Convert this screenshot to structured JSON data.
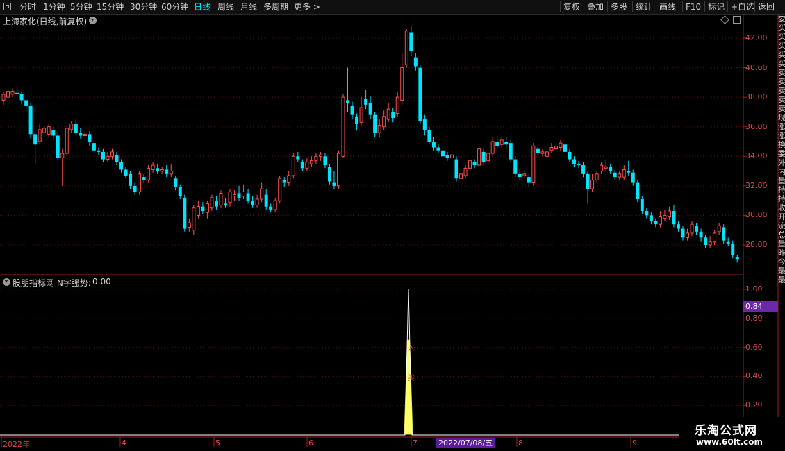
{
  "toolbar": {
    "left": [
      "分时",
      "1分钟",
      "5分钟",
      "15分钟",
      "30分钟",
      "60分钟",
      "日线",
      "周线",
      "月线",
      "多周期",
      "更多 >"
    ],
    "active_index": 6,
    "right": [
      "复权",
      "叠加",
      "多股",
      "统计",
      "画线",
      "F10",
      "标记",
      "+自选",
      "返回"
    ]
  },
  "chart": {
    "stock_title": "上海家化(日线,前复权)",
    "price_axis": [
      "42.00",
      "40.00",
      "38.00",
      "36.00",
      "34.00",
      "32.00",
      "30.00",
      "28.00"
    ],
    "indicator_title": "股朋指标网 N字强势:",
    "indicator_value": "0.00",
    "indicator_axis": [
      "1.00",
      "0.80",
      "0.60",
      "0.40",
      "0.20"
    ],
    "current_value": "0.84",
    "date_badge": "2022/07/08/五",
    "time_axis": [
      "2022年",
      "4",
      "5",
      "6",
      "7",
      "8",
      "9"
    ],
    "signal_labels": [
      "买",
      "入"
    ],
    "up_color": "#ff5050",
    "down_color": "#00e5ff"
  },
  "right_strip": "委买买买买买卖卖卖卖卖现涨涨换委外内量持持收开流总量昨今最最",
  "watermark": {
    "title": "乐淘公式网",
    "url": "www.60lt.com"
  },
  "chart_data": {
    "type": "candlestick",
    "price_axis_range": [
      27,
      43
    ],
    "indicator": {
      "name": "N字强势",
      "range": [
        0,
        1
      ],
      "peak": 1.0,
      "fill_peak": 0.65,
      "peak_date": "2022/07/08"
    },
    "candles": [
      {
        "o": 37.8,
        "c": 38.2,
        "h": 38.4,
        "l": 37.5
      },
      {
        "o": 38.0,
        "c": 38.4,
        "h": 38.6,
        "l": 37.8
      },
      {
        "o": 38.2,
        "c": 38.4,
        "h": 38.6,
        "l": 38.0
      },
      {
        "o": 38.3,
        "c": 38.2,
        "h": 38.9,
        "l": 37.9
      },
      {
        "o": 38.2,
        "c": 37.8,
        "h": 38.4,
        "l": 37.5
      },
      {
        "o": 37.8,
        "c": 37.4,
        "h": 38.0,
        "l": 37.1
      },
      {
        "o": 37.4,
        "c": 35.5,
        "h": 37.6,
        "l": 35.2
      },
      {
        "o": 35.5,
        "c": 34.8,
        "h": 35.8,
        "l": 33.5
      },
      {
        "o": 35.0,
        "c": 35.8,
        "h": 36.2,
        "l": 34.8
      },
      {
        "o": 35.6,
        "c": 35.9,
        "h": 36.1,
        "l": 35.3
      },
      {
        "o": 35.5,
        "c": 36.0,
        "h": 36.2,
        "l": 35.3
      },
      {
        "o": 35.8,
        "c": 35.4,
        "h": 36.0,
        "l": 35.1
      },
      {
        "o": 35.4,
        "c": 33.9,
        "h": 35.6,
        "l": 33.7
      },
      {
        "o": 33.9,
        "c": 34.2,
        "h": 34.5,
        "l": 32.0
      },
      {
        "o": 34.2,
        "c": 35.9,
        "h": 36.1,
        "l": 34.0
      },
      {
        "o": 35.8,
        "c": 36.2,
        "h": 36.4,
        "l": 35.6
      },
      {
        "o": 36.2,
        "c": 35.6,
        "h": 36.5,
        "l": 35.4
      },
      {
        "o": 35.6,
        "c": 35.4,
        "h": 35.9,
        "l": 35.2
      },
      {
        "o": 35.4,
        "c": 35.5,
        "h": 35.8,
        "l": 35.1
      },
      {
        "o": 35.5,
        "c": 35.0,
        "h": 35.7,
        "l": 34.7
      },
      {
        "o": 34.9,
        "c": 34.4,
        "h": 35.1,
        "l": 34.2
      },
      {
        "o": 34.4,
        "c": 34.3,
        "h": 34.6,
        "l": 34.1
      },
      {
        "o": 34.3,
        "c": 33.8,
        "h": 34.5,
        "l": 33.6
      },
      {
        "o": 33.8,
        "c": 34.0,
        "h": 34.3,
        "l": 33.6
      },
      {
        "o": 34.0,
        "c": 34.3,
        "h": 34.5,
        "l": 33.8
      },
      {
        "o": 34.1,
        "c": 33.6,
        "h": 34.3,
        "l": 33.4
      },
      {
        "o": 33.6,
        "c": 33.1,
        "h": 33.8,
        "l": 32.9
      },
      {
        "o": 33.1,
        "c": 32.7,
        "h": 33.3,
        "l": 32.5
      },
      {
        "o": 32.8,
        "c": 32.0,
        "h": 33.0,
        "l": 31.8
      },
      {
        "o": 32.0,
        "c": 31.6,
        "h": 32.2,
        "l": 31.4
      },
      {
        "o": 31.6,
        "c": 32.8,
        "h": 33.0,
        "l": 31.4
      },
      {
        "o": 32.6,
        "c": 32.4,
        "h": 32.8,
        "l": 32.2
      },
      {
        "o": 32.4,
        "c": 33.2,
        "h": 33.4,
        "l": 32.2
      },
      {
        "o": 33.1,
        "c": 33.4,
        "h": 33.6,
        "l": 32.9
      },
      {
        "o": 33.2,
        "c": 33.0,
        "h": 33.5,
        "l": 32.8
      },
      {
        "o": 33.0,
        "c": 33.1,
        "h": 33.3,
        "l": 32.8
      },
      {
        "o": 33.1,
        "c": 32.8,
        "h": 33.4,
        "l": 32.6
      },
      {
        "o": 32.8,
        "c": 33.0,
        "h": 33.5,
        "l": 32.6
      },
      {
        "o": 32.5,
        "c": 31.9,
        "h": 32.7,
        "l": 31.7
      },
      {
        "o": 31.9,
        "c": 31.3,
        "h": 32.1,
        "l": 31.1
      },
      {
        "o": 31.2,
        "c": 29.1,
        "h": 31.4,
        "l": 28.9
      },
      {
        "o": 29.2,
        "c": 29.5,
        "h": 29.8,
        "l": 28.9
      },
      {
        "o": 29.0,
        "c": 30.5,
        "h": 30.7,
        "l": 28.7
      },
      {
        "o": 30.0,
        "c": 30.6,
        "h": 31.0,
        "l": 29.8
      },
      {
        "o": 30.6,
        "c": 30.3,
        "h": 30.9,
        "l": 30.1
      },
      {
        "o": 30.2,
        "c": 30.8,
        "h": 31.0,
        "l": 29.8
      },
      {
        "o": 30.5,
        "c": 31.2,
        "h": 31.4,
        "l": 30.3
      },
      {
        "o": 31.0,
        "c": 30.6,
        "h": 31.3,
        "l": 30.4
      },
      {
        "o": 30.7,
        "c": 31.5,
        "h": 31.7,
        "l": 30.5
      },
      {
        "o": 30.8,
        "c": 30.7,
        "h": 31.2,
        "l": 30.5
      },
      {
        "o": 30.9,
        "c": 31.6,
        "h": 31.8,
        "l": 30.6
      },
      {
        "o": 31.3,
        "c": 31.4,
        "h": 31.7,
        "l": 31.0
      },
      {
        "o": 31.5,
        "c": 31.2,
        "h": 32.0,
        "l": 31.0
      },
      {
        "o": 31.3,
        "c": 31.6,
        "h": 32.1,
        "l": 31.1
      },
      {
        "o": 31.5,
        "c": 31.0,
        "h": 31.8,
        "l": 30.8
      },
      {
        "o": 31.0,
        "c": 30.7,
        "h": 31.3,
        "l": 30.5
      },
      {
        "o": 30.7,
        "c": 31.1,
        "h": 31.4,
        "l": 30.5
      },
      {
        "o": 31.1,
        "c": 31.8,
        "h": 32.2,
        "l": 30.9
      },
      {
        "o": 31.4,
        "c": 30.6,
        "h": 31.8,
        "l": 30.4
      },
      {
        "o": 30.6,
        "c": 30.4,
        "h": 30.8,
        "l": 30.2
      },
      {
        "o": 30.4,
        "c": 31.0,
        "h": 31.2,
        "l": 30.2
      },
      {
        "o": 31.0,
        "c": 32.5,
        "h": 32.7,
        "l": 30.8
      },
      {
        "o": 32.4,
        "c": 32.2,
        "h": 32.6,
        "l": 31.9
      },
      {
        "o": 32.2,
        "c": 32.7,
        "h": 33.0,
        "l": 32.0
      },
      {
        "o": 32.7,
        "c": 34.0,
        "h": 34.2,
        "l": 32.5
      },
      {
        "o": 34.0,
        "c": 33.8,
        "h": 34.3,
        "l": 33.6
      },
      {
        "o": 33.6,
        "c": 33.2,
        "h": 33.8,
        "l": 33.0
      },
      {
        "o": 33.2,
        "c": 33.6,
        "h": 33.9,
        "l": 33.0
      },
      {
        "o": 33.5,
        "c": 33.7,
        "h": 34.0,
        "l": 33.3
      },
      {
        "o": 33.7,
        "c": 34.0,
        "h": 34.2,
        "l": 33.5
      },
      {
        "o": 34.0,
        "c": 34.1,
        "h": 34.3,
        "l": 33.7
      },
      {
        "o": 34.0,
        "c": 33.4,
        "h": 34.2,
        "l": 33.2
      },
      {
        "o": 33.3,
        "c": 32.3,
        "h": 33.5,
        "l": 32.1
      },
      {
        "o": 32.2,
        "c": 32.0,
        "h": 33.0,
        "l": 31.8
      },
      {
        "o": 32.0,
        "c": 34.2,
        "h": 34.4,
        "l": 31.8
      },
      {
        "o": 34.0,
        "c": 38.0,
        "h": 38.2,
        "l": 33.9
      },
      {
        "o": 37.8,
        "c": 37.6,
        "h": 40.0,
        "l": 37.0
      },
      {
        "o": 37.4,
        "c": 36.8,
        "h": 37.7,
        "l": 36.5
      },
      {
        "o": 36.7,
        "c": 36.2,
        "h": 36.9,
        "l": 35.8
      },
      {
        "o": 36.3,
        "c": 37.3,
        "h": 38.0,
        "l": 36.1
      },
      {
        "o": 37.9,
        "c": 37.5,
        "h": 38.5,
        "l": 37.2
      },
      {
        "o": 37.6,
        "c": 36.8,
        "h": 38.1,
        "l": 36.5
      },
      {
        "o": 36.8,
        "c": 35.6,
        "h": 37.0,
        "l": 35.3
      },
      {
        "o": 35.6,
        "c": 36.1,
        "h": 36.5,
        "l": 35.3
      },
      {
        "o": 36.0,
        "c": 36.7,
        "h": 37.1,
        "l": 35.8
      },
      {
        "o": 36.5,
        "c": 37.2,
        "h": 37.6,
        "l": 36.3
      },
      {
        "o": 37.0,
        "c": 36.6,
        "h": 37.3,
        "l": 36.3
      },
      {
        "o": 36.9,
        "c": 38.0,
        "h": 38.4,
        "l": 36.7
      },
      {
        "o": 37.8,
        "c": 40.0,
        "h": 41.0,
        "l": 37.5
      },
      {
        "o": 40.2,
        "c": 42.5,
        "h": 42.6,
        "l": 40.0
      },
      {
        "o": 42.4,
        "c": 41.1,
        "h": 42.8,
        "l": 40.8
      },
      {
        "o": 40.7,
        "c": 40.1,
        "h": 41.0,
        "l": 39.8
      },
      {
        "o": 40.0,
        "c": 36.4,
        "h": 40.2,
        "l": 36.2
      },
      {
        "o": 36.5,
        "c": 35.8,
        "h": 36.8,
        "l": 35.4
      },
      {
        "o": 35.8,
        "c": 35.0,
        "h": 36.0,
        "l": 34.8
      },
      {
        "o": 35.0,
        "c": 34.6,
        "h": 35.3,
        "l": 34.4
      },
      {
        "o": 34.6,
        "c": 34.4,
        "h": 34.8,
        "l": 34.2
      },
      {
        "o": 34.4,
        "c": 34.0,
        "h": 34.6,
        "l": 33.8
      },
      {
        "o": 34.1,
        "c": 33.9,
        "h": 34.3,
        "l": 33.7
      },
      {
        "o": 33.9,
        "c": 34.1,
        "h": 34.4,
        "l": 33.7
      },
      {
        "o": 33.8,
        "c": 32.5,
        "h": 34.0,
        "l": 32.3
      },
      {
        "o": 32.5,
        "c": 32.8,
        "h": 33.1,
        "l": 32.3
      },
      {
        "o": 32.7,
        "c": 33.2,
        "h": 33.4,
        "l": 32.5
      },
      {
        "o": 33.2,
        "c": 33.7,
        "h": 33.9,
        "l": 33.0
      },
      {
        "o": 33.6,
        "c": 33.4,
        "h": 33.8,
        "l": 33.2
      },
      {
        "o": 33.4,
        "c": 34.5,
        "h": 34.8,
        "l": 33.3
      },
      {
        "o": 34.3,
        "c": 33.6,
        "h": 34.5,
        "l": 33.4
      },
      {
        "o": 33.7,
        "c": 34.2,
        "h": 34.4,
        "l": 33.5
      },
      {
        "o": 34.2,
        "c": 35.0,
        "h": 35.3,
        "l": 34.0
      },
      {
        "o": 35.0,
        "c": 34.7,
        "h": 35.4,
        "l": 34.5
      },
      {
        "o": 34.8,
        "c": 35.1,
        "h": 35.3,
        "l": 34.6
      },
      {
        "o": 35.0,
        "c": 34.8,
        "h": 35.3,
        "l": 34.6
      },
      {
        "o": 34.9,
        "c": 33.8,
        "h": 35.1,
        "l": 33.6
      },
      {
        "o": 33.8,
        "c": 32.8,
        "h": 34.0,
        "l": 32.6
      },
      {
        "o": 32.8,
        "c": 32.6,
        "h": 33.1,
        "l": 32.4
      },
      {
        "o": 32.7,
        "c": 32.8,
        "h": 33.0,
        "l": 32.5
      },
      {
        "o": 32.6,
        "c": 32.2,
        "h": 32.8,
        "l": 31.9
      },
      {
        "o": 32.2,
        "c": 34.7,
        "h": 34.9,
        "l": 32.0
      },
      {
        "o": 34.5,
        "c": 34.2,
        "h": 34.7,
        "l": 34.0
      },
      {
        "o": 34.2,
        "c": 34.3,
        "h": 34.5,
        "l": 34.0
      },
      {
        "o": 34.0,
        "c": 34.3,
        "h": 34.6,
        "l": 33.8
      },
      {
        "o": 34.4,
        "c": 34.6,
        "h": 34.9,
        "l": 34.2
      },
      {
        "o": 34.5,
        "c": 34.7,
        "h": 35.0,
        "l": 34.3
      },
      {
        "o": 34.6,
        "c": 34.9,
        "h": 35.1,
        "l": 34.4
      },
      {
        "o": 34.8,
        "c": 34.3,
        "h": 35.0,
        "l": 34.1
      },
      {
        "o": 34.3,
        "c": 33.8,
        "h": 34.5,
        "l": 33.6
      },
      {
        "o": 33.8,
        "c": 33.5,
        "h": 34.0,
        "l": 33.3
      },
      {
        "o": 33.5,
        "c": 33.4,
        "h": 33.7,
        "l": 33.2
      },
      {
        "o": 33.4,
        "c": 32.8,
        "h": 33.6,
        "l": 32.6
      },
      {
        "o": 32.8,
        "c": 31.8,
        "h": 33.0,
        "l": 30.8
      },
      {
        "o": 31.8,
        "c": 32.4,
        "h": 32.8,
        "l": 31.6
      },
      {
        "o": 32.4,
        "c": 32.8,
        "h": 33.0,
        "l": 32.2
      },
      {
        "o": 33.0,
        "c": 33.4,
        "h": 33.6,
        "l": 32.8
      },
      {
        "o": 33.2,
        "c": 33.3,
        "h": 33.8,
        "l": 33.0
      },
      {
        "o": 33.3,
        "c": 33.0,
        "h": 33.5,
        "l": 32.8
      },
      {
        "o": 32.9,
        "c": 32.6,
        "h": 33.1,
        "l": 32.4
      },
      {
        "o": 32.6,
        "c": 32.8,
        "h": 33.0,
        "l": 32.4
      },
      {
        "o": 32.6,
        "c": 33.1,
        "h": 33.4,
        "l": 32.4
      },
      {
        "o": 33.0,
        "c": 32.9,
        "h": 33.7,
        "l": 32.7
      },
      {
        "o": 32.9,
        "c": 32.2,
        "h": 33.1,
        "l": 32.0
      },
      {
        "o": 32.2,
        "c": 31.1,
        "h": 32.4,
        "l": 30.9
      },
      {
        "o": 31.1,
        "c": 30.3,
        "h": 31.3,
        "l": 30.1
      },
      {
        "o": 30.3,
        "c": 30.0,
        "h": 30.5,
        "l": 29.8
      },
      {
        "o": 30.0,
        "c": 29.6,
        "h": 30.2,
        "l": 29.4
      },
      {
        "o": 29.6,
        "c": 29.4,
        "h": 29.8,
        "l": 29.2
      },
      {
        "o": 29.4,
        "c": 29.9,
        "h": 30.3,
        "l": 29.2
      },
      {
        "o": 29.8,
        "c": 30.0,
        "h": 30.4,
        "l": 29.6
      },
      {
        "o": 29.9,
        "c": 30.3,
        "h": 30.6,
        "l": 29.7
      },
      {
        "o": 30.3,
        "c": 29.4,
        "h": 30.7,
        "l": 29.2
      },
      {
        "o": 29.4,
        "c": 29.1,
        "h": 29.6,
        "l": 28.9
      },
      {
        "o": 29.1,
        "c": 28.5,
        "h": 29.3,
        "l": 28.3
      },
      {
        "o": 28.5,
        "c": 28.8,
        "h": 29.1,
        "l": 28.3
      },
      {
        "o": 28.8,
        "c": 29.4,
        "h": 29.6,
        "l": 28.6
      },
      {
        "o": 29.3,
        "c": 28.9,
        "h": 29.5,
        "l": 28.7
      },
      {
        "o": 28.9,
        "c": 28.5,
        "h": 29.1,
        "l": 28.2
      },
      {
        "o": 28.5,
        "c": 28.0,
        "h": 28.7,
        "l": 27.8
      },
      {
        "o": 28.0,
        "c": 28.2,
        "h": 28.6,
        "l": 27.8
      },
      {
        "o": 28.2,
        "c": 28.8,
        "h": 29.0,
        "l": 28.0
      },
      {
        "o": 28.9,
        "c": 29.3,
        "h": 29.5,
        "l": 28.7
      },
      {
        "o": 29.2,
        "c": 28.3,
        "h": 29.4,
        "l": 28.1
      },
      {
        "o": 28.2,
        "c": 28.1,
        "h": 28.5,
        "l": 27.9
      },
      {
        "o": 28.1,
        "c": 27.3,
        "h": 28.3,
        "l": 27.1
      },
      {
        "o": 27.2,
        "c": 27.0,
        "h": 27.3,
        "l": 26.8
      }
    ]
  }
}
